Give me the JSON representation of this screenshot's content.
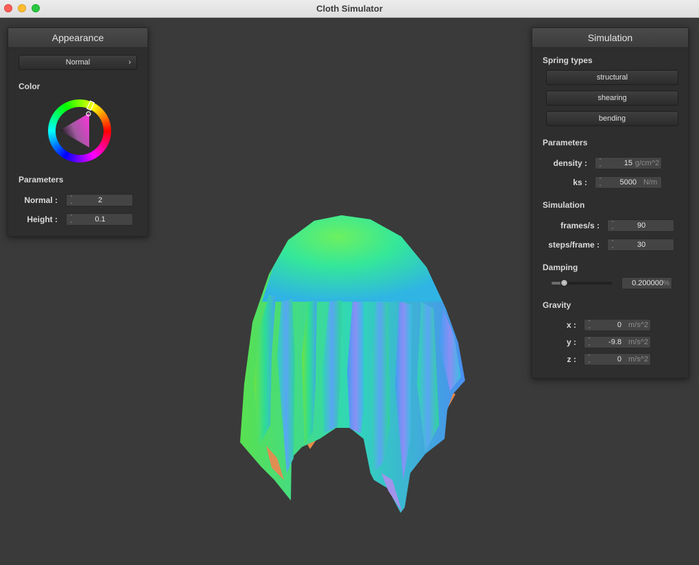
{
  "window": {
    "title": "Cloth Simulator"
  },
  "appearance": {
    "title": "Appearance",
    "shader": {
      "selected": "Normal"
    },
    "color_label": "Color",
    "params_label": "Parameters",
    "normal": {
      "label": "Normal :",
      "value": "2"
    },
    "height": {
      "label": "Height :",
      "value": "0.1"
    }
  },
  "simulation": {
    "title": "Simulation",
    "spring_types_label": "Spring types",
    "springs": [
      {
        "label": "structural"
      },
      {
        "label": "shearing"
      },
      {
        "label": "bending"
      }
    ],
    "parameters_label": "Parameters",
    "density": {
      "label": "density :",
      "value": "15",
      "unit": "g/cm^2"
    },
    "ks": {
      "label": "ks :",
      "value": "5000",
      "unit": "N/m"
    },
    "simulation_label": "Simulation",
    "frames": {
      "label": "frames/s :",
      "value": "90"
    },
    "steps": {
      "label": "steps/frame :",
      "value": "30"
    },
    "damping_label": "Damping",
    "damping": {
      "value": "0.200000",
      "unit": "%",
      "slider_fraction": 0.2
    },
    "gravity_label": "Gravity",
    "gravity": [
      {
        "label": "x :",
        "value": "0",
        "unit": "m/s^2"
      },
      {
        "label": "y :",
        "value": "-9.8",
        "unit": "m/s^2"
      },
      {
        "label": "z :",
        "value": "0",
        "unit": "m/s^2"
      }
    ]
  }
}
